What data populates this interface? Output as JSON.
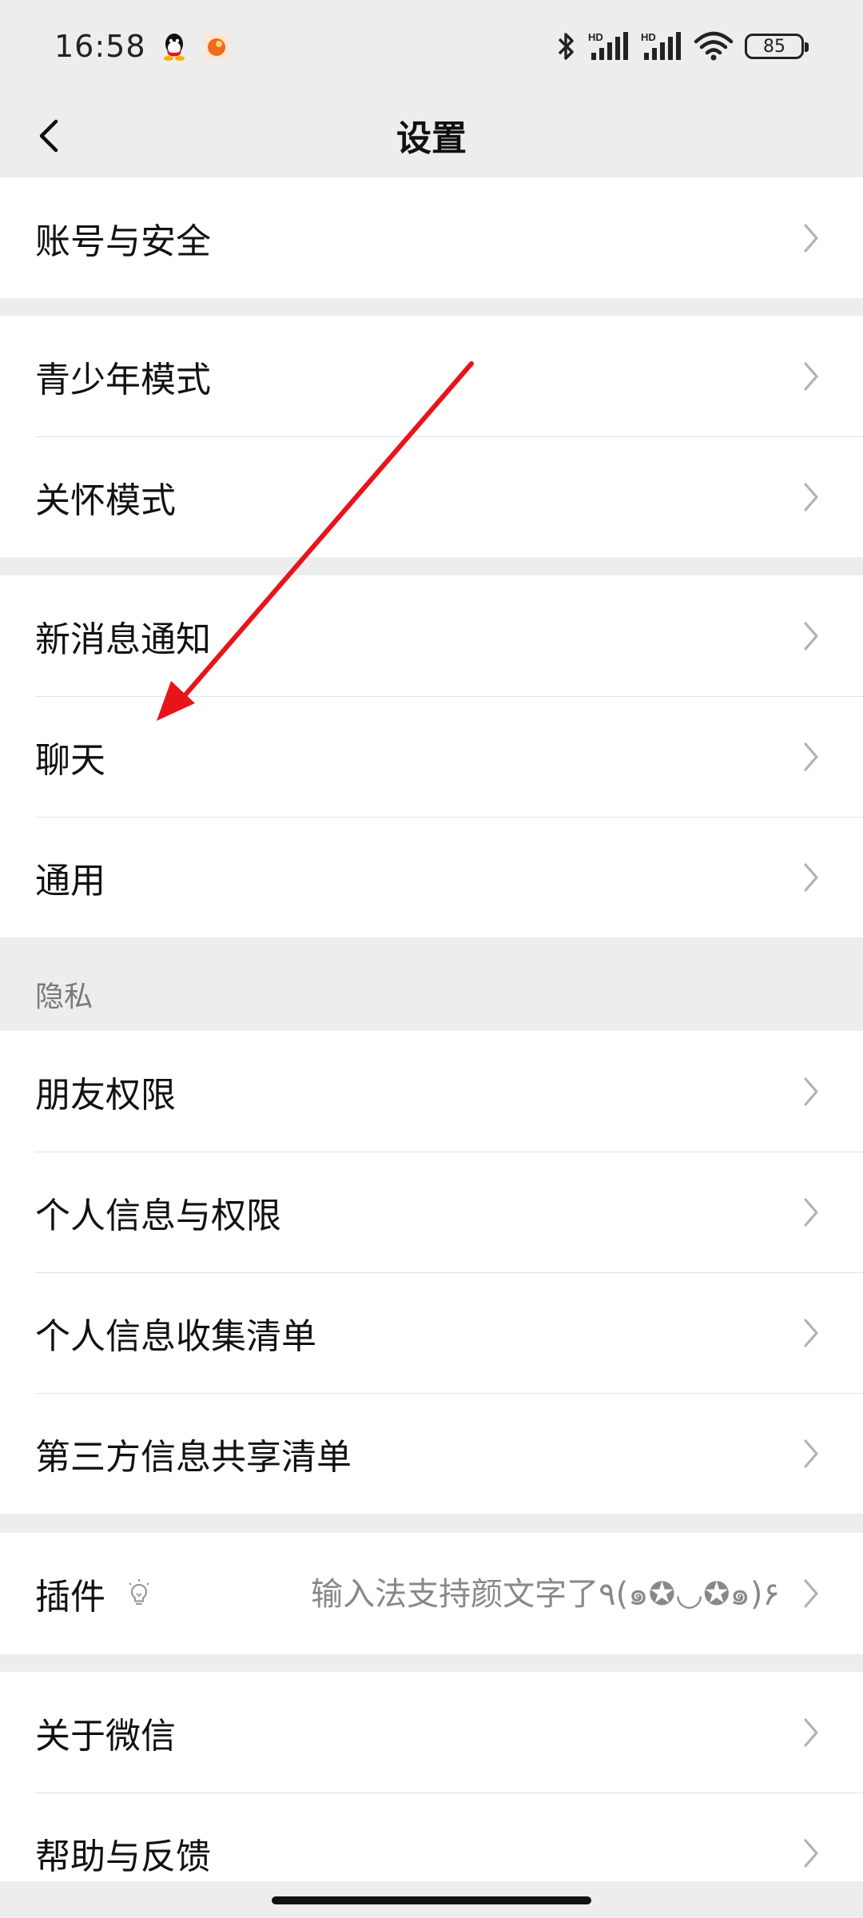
{
  "status_bar": {
    "time": "16:58",
    "network_label": "HD",
    "battery": "85",
    "icons": [
      "qq-icon",
      "app-icon",
      "bluetooth-icon",
      "signal-icon",
      "signal-icon",
      "wifi-icon",
      "battery-icon"
    ]
  },
  "nav": {
    "title": "设置",
    "back_icon": "chevron-left-icon"
  },
  "groups": {
    "account": [
      "账号与安全"
    ],
    "modes": [
      "青少年模式",
      "关怀模式"
    ],
    "general": [
      "新消息通知",
      "聊天",
      "通用"
    ],
    "privacy_header": "隐私",
    "privacy": [
      "朋友权限",
      "个人信息与权限",
      "个人信息收集清单",
      "第三方信息共享清单"
    ],
    "plugins": {
      "label": "插件",
      "value": "输入法支持颜文字了٩(๑✪◡✪๑)۶",
      "icon": "lightbulb-icon"
    },
    "about": [
      "关于微信",
      "帮助与反馈"
    ]
  },
  "colors": {
    "background": "#ededed",
    "card": "#ffffff",
    "annotation_arrow": "#e8141c"
  }
}
